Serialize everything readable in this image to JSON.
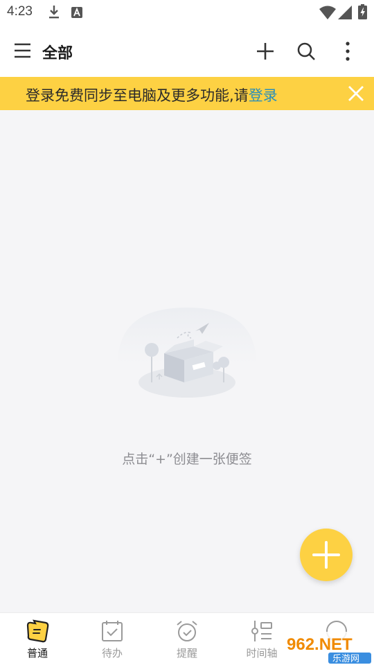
{
  "status_bar": {
    "time": "4:23"
  },
  "header": {
    "title": "全部"
  },
  "banner": {
    "text": "登录免费同步至电脑及更多功能,请",
    "link": "登录"
  },
  "empty_state": {
    "hint": "点击“+”创建一张便签"
  },
  "bottom_nav": {
    "items": [
      {
        "label": "普通",
        "active": true
      },
      {
        "label": "待办",
        "active": false
      },
      {
        "label": "提醒",
        "active": false
      },
      {
        "label": "时间轴",
        "active": false
      }
    ]
  },
  "watermark": {
    "brand": "962.NET",
    "sub": "乐游网"
  },
  "colors": {
    "accent": "#fdd143",
    "link": "#2a8fb9"
  }
}
